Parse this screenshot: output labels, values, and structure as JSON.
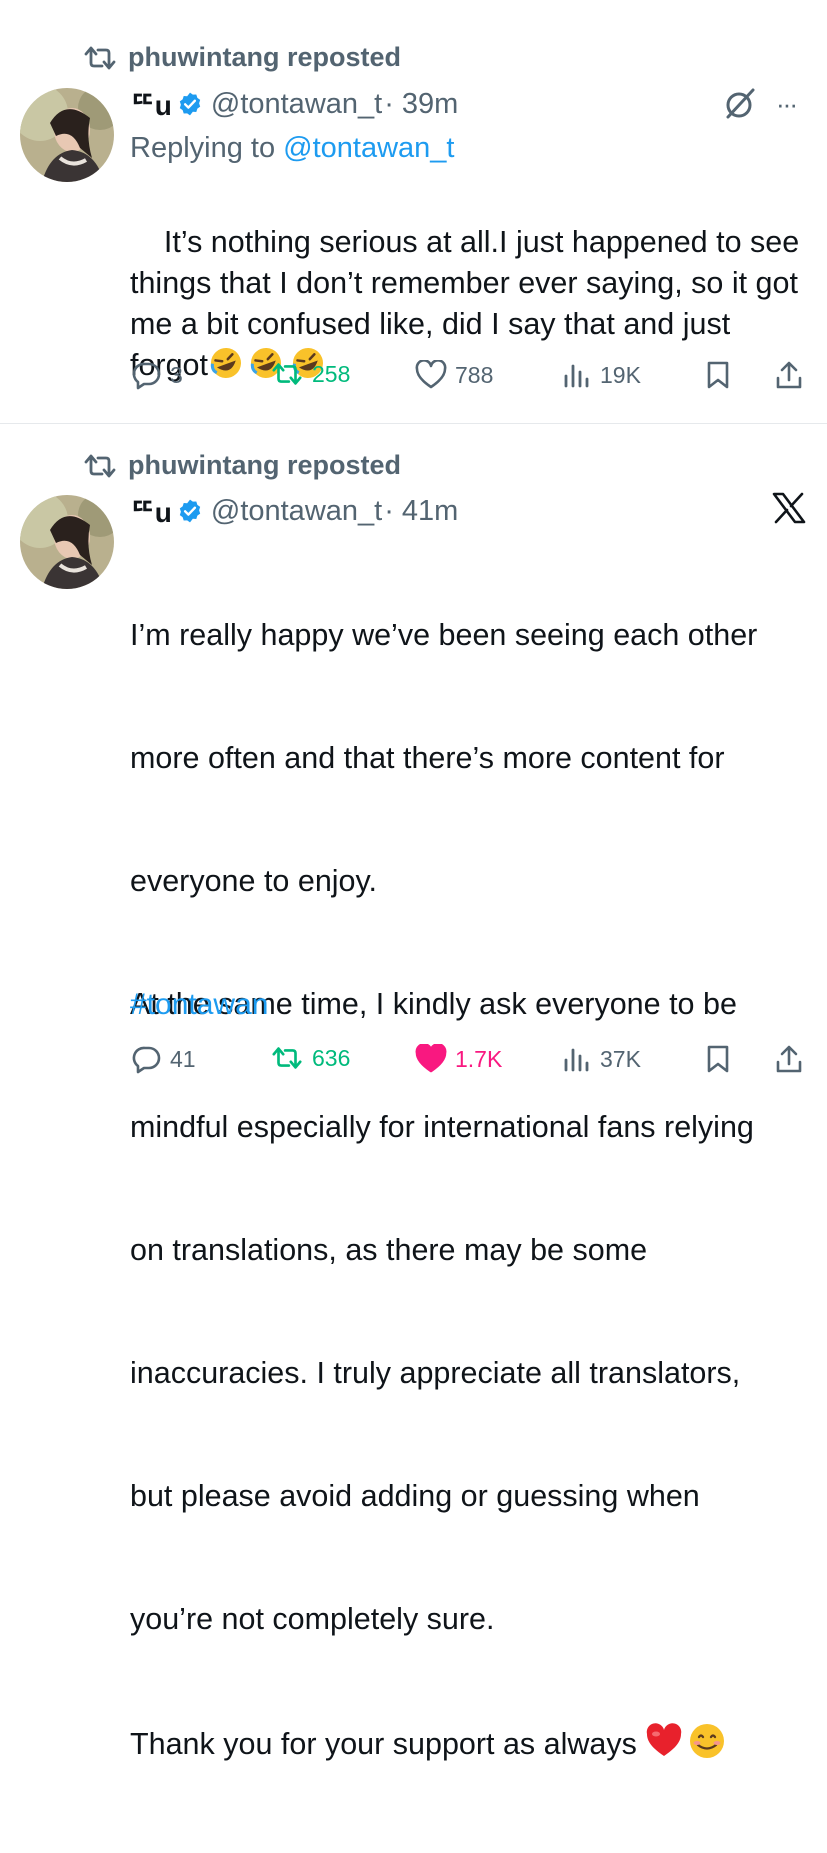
{
  "tweets": [
    {
      "repost_label": "phuwintang reposted",
      "name": "ᄄu",
      "handle": "@tontawan_t",
      "time": "· 39m",
      "replying_prefix": "Replying to",
      "replying_handle": "@tontawan_t",
      "text": "It’s nothing serious at all.I just happened to see things that I don’t remember ever saying, so it got me a bit confused like, did I say that and just forgot",
      "actions": {
        "replies": "3",
        "reposts": "258",
        "likes": "788",
        "views": "19K"
      },
      "more_label": "···"
    },
    {
      "repost_label": "phuwintang reposted",
      "name": "ᄄu",
      "handle": "@tontawan_t",
      "time": "· 41m",
      "text_lines": [
        "I’m really happy we’ve been seeing each other",
        "more often and that there’s more content for",
        "everyone to enjoy.",
        "At the same time, I kindly ask everyone to be",
        "mindful especially for international fans relying",
        "on translations, as there may be some",
        "inaccuracies. I truly appreciate all translators,",
        "but please avoid adding or guessing when",
        "you’re not completely sure.",
        "Thank you for your support as always"
      ],
      "hashtag": "#tontawan",
      "actions": {
        "replies": "41",
        "reposts": "636",
        "likes": "1.7K",
        "views": "37K"
      }
    }
  ],
  "colors": {
    "accent": "#1d9bf0",
    "muted": "#536471",
    "repost_green": "#00ba7c",
    "like_pink": "#f91880"
  },
  "icons": [
    "repost-icon",
    "verified-badge-icon",
    "grok-icon",
    "more-icon",
    "x-logo-icon",
    "reply-icon",
    "like-icon",
    "views-icon",
    "bookmark-icon",
    "share-icon"
  ]
}
